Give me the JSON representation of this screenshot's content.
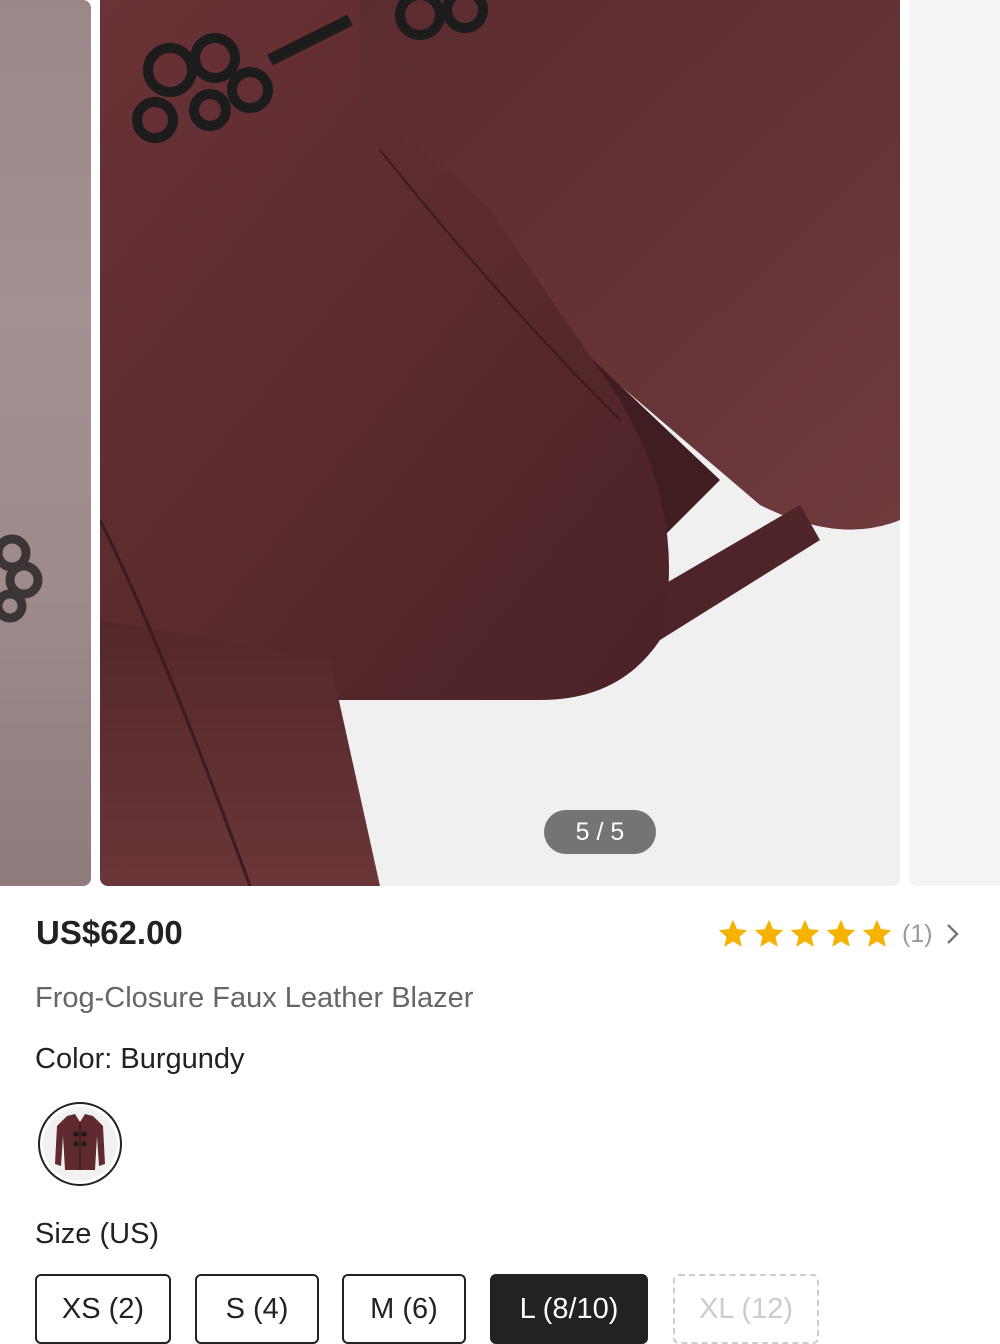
{
  "gallery": {
    "counter": "5 / 5"
  },
  "product": {
    "price": "US$62.00",
    "title": "Frog-Closure Faux Leather Blazer",
    "rating": {
      "stars": 5,
      "count_text": "(1)"
    }
  },
  "color": {
    "label": "Color: Burgundy",
    "selected": "Burgundy"
  },
  "size": {
    "label": "Size (US)",
    "options": [
      {
        "label": "XS (2)",
        "state": "available"
      },
      {
        "label": "S (4)",
        "state": "available"
      },
      {
        "label": "M (6)",
        "state": "available"
      },
      {
        "label": "L (8/10)",
        "state": "selected"
      },
      {
        "label": "XL (12)",
        "state": "unavailable"
      }
    ]
  },
  "colors": {
    "star": "#F5B300",
    "selected_bg": "#222222",
    "leather": "#5e2a2d"
  }
}
